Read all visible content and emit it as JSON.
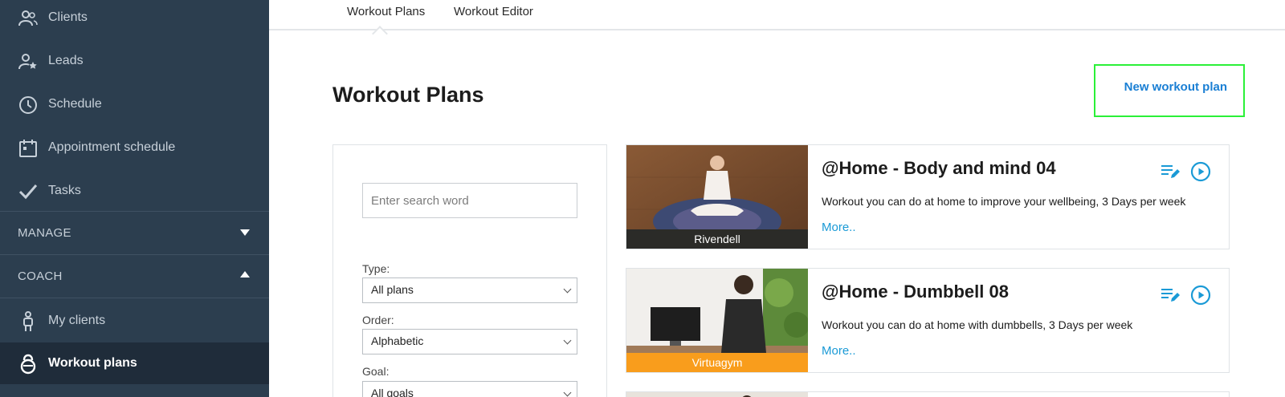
{
  "sidebar": {
    "items": [
      {
        "label": "Clients",
        "icon": "users-icon"
      },
      {
        "label": "Leads",
        "icon": "user-star-icon"
      },
      {
        "label": "Schedule",
        "icon": "clock-icon"
      },
      {
        "label": "Appointment schedule",
        "icon": "calendar-icon"
      },
      {
        "label": "Tasks",
        "icon": "check-icon"
      }
    ],
    "manage_label": "MANAGE",
    "coach_label": "COACH",
    "coach_items": [
      {
        "label": "My clients",
        "icon": "person-icon"
      },
      {
        "label": "Workout plans",
        "icon": "kettlebell-icon"
      }
    ]
  },
  "tabs": {
    "workout_plans": "Workout Plans",
    "workout_editor": "Workout Editor"
  },
  "main": {
    "title": "Workout Plans",
    "new_plan_label": "New workout plan"
  },
  "filters": {
    "search_placeholder": "Enter search word",
    "type_label": "Type:",
    "type_value": "All plans",
    "order_label": "Order:",
    "order_value": "Alphabetic",
    "goal_label": "Goal:",
    "goal_value": "All goals"
  },
  "plans": [
    {
      "title": "@Home - Body and mind 04",
      "description": "Workout you can do at home to improve your wellbeing, 3 Days per week",
      "more": "More..",
      "source": "Rivendell",
      "caption_color": "#2b2b28"
    },
    {
      "title": "@Home - Dumbbell 08",
      "description": "Workout you can do at home with dumbbells, 3 Days per week",
      "more": "More..",
      "source": "Virtuagym",
      "caption_color": "#f99d1c"
    }
  ],
  "colors": {
    "sidebar_bg": "#2c3e4f",
    "accent_link": "#1a7fd4",
    "action_icon": "#1a9ad6",
    "highlight_border": "#2bf038"
  }
}
